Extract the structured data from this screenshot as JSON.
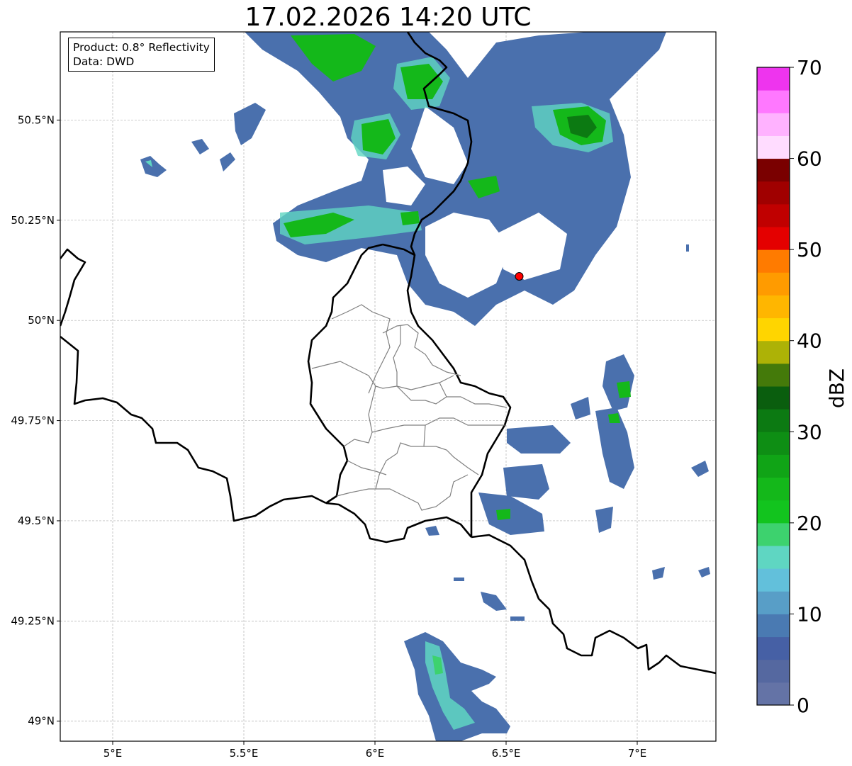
{
  "title": "17.02.2026 14:20 UTC",
  "info_box": {
    "product": "Product: 0.8° Reflectivity",
    "data": "Data: DWD"
  },
  "map": {
    "lon_range": [
      4.8,
      7.3
    ],
    "lat_range": [
      48.95,
      50.72
    ],
    "x_ticks": [
      {
        "value": 5.0,
        "label": "5°E"
      },
      {
        "value": 5.5,
        "label": "5.5°E"
      },
      {
        "value": 6.0,
        "label": "6°E"
      },
      {
        "value": 6.5,
        "label": "6.5°E"
      },
      {
        "value": 7.0,
        "label": "7°E"
      }
    ],
    "y_ticks": [
      {
        "value": 49.0,
        "label": "49°N"
      },
      {
        "value": 49.25,
        "label": "49.25°N"
      },
      {
        "value": 49.5,
        "label": "49.5°N"
      },
      {
        "value": 49.75,
        "label": "49.75°N"
      },
      {
        "value": 50.0,
        "label": "50°N"
      },
      {
        "value": 50.25,
        "label": "50.25°N"
      },
      {
        "value": 50.5,
        "label": "50.5°N"
      }
    ],
    "radar_site": {
      "lon": 6.55,
      "lat": 50.11,
      "color": "#ff0000"
    }
  },
  "colorbar": {
    "label": "dBZ",
    "range": [
      0,
      70
    ],
    "ticks": [
      {
        "value": 0,
        "label": "0"
      },
      {
        "value": 10,
        "label": "10"
      },
      {
        "value": 20,
        "label": "20"
      },
      {
        "value": 30,
        "label": "30"
      },
      {
        "value": 40,
        "label": "40"
      },
      {
        "value": 50,
        "label": "50"
      },
      {
        "value": 60,
        "label": "60"
      },
      {
        "value": 70,
        "label": "70"
      }
    ],
    "colors": [
      "#6473a6",
      "#5568a0",
      "#4660a5",
      "#4a7ab2",
      "#589ec7",
      "#62c0db",
      "#5fd6c2",
      "#3dd26e",
      "#12c41e",
      "#14b81a",
      "#10a416",
      "#0e8e14",
      "#0c7a12",
      "#0a5e0e",
      "#447a0a",
      "#adb206",
      "#ffd500",
      "#ffb600",
      "#ff9b00",
      "#ff7b00",
      "#e40000",
      "#c00000",
      "#a00000",
      "#7a0000",
      "#ffdcff",
      "#ffb2ff",
      "#ff78ff",
      "#ee34ee"
    ]
  }
}
